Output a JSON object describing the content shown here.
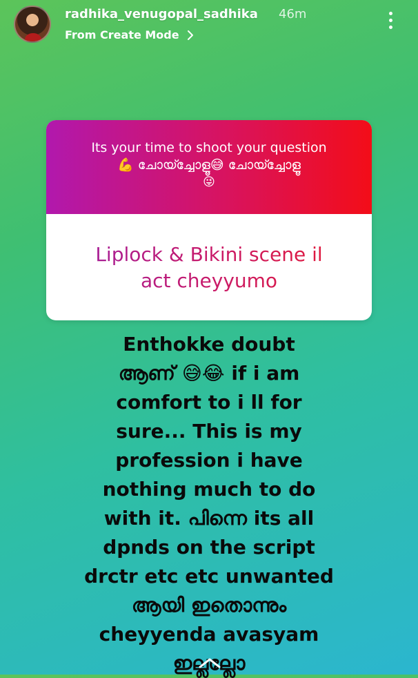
{
  "header": {
    "username": "radhika_venugopal_sadhika",
    "time": "46m",
    "subtitle": "From Create Mode"
  },
  "question_card": {
    "prompt_line1": "Its your time to shoot your question",
    "prompt_line2": "💪 ചോയ്ച്ചോളൂ😅 ചോയ്ച്ചോളൂ",
    "prompt_line3": "😜",
    "answer_line1": "Liplock & Bikini scene il",
    "answer_line2": "act cheyyumo"
  },
  "reply": {
    "lines": [
      "Enthokke doubt",
      "ആണ് 😅😂 if i am",
      "comfort to i ll for",
      "sure... This is my",
      "profession i have",
      "nothing much to do",
      "with it. പിന്നെ its all",
      "dpnds on the script",
      "drctr etc etc unwanted",
      "ആയി ഇതൊന്നും",
      "cheyyenda avasyam",
      "ഇല്ലല്ലോ"
    ]
  },
  "icons": {
    "more": "more-vertical-icon",
    "chevron": "chevron-right-icon",
    "home": "chevron-up-icon"
  }
}
